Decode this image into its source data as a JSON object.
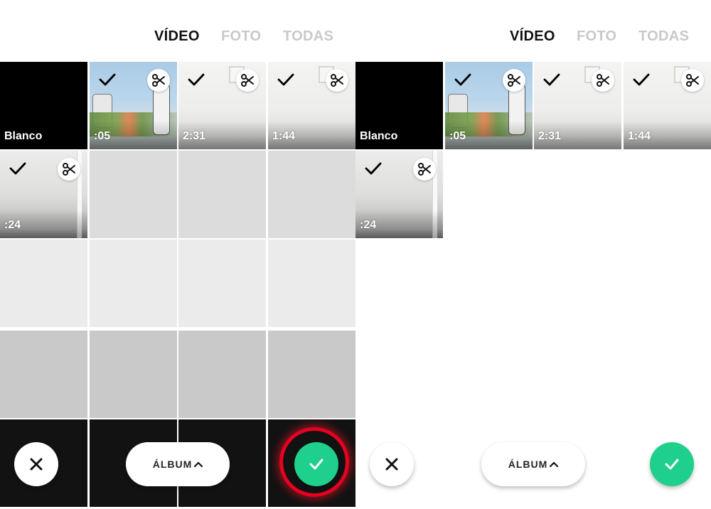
{
  "colors": {
    "accent_green": "#1fcf8c",
    "highlight_red": "#e8001f",
    "tab_active": "#111111",
    "tab_inactive": "#c9c9c9"
  },
  "tabs": [
    "VÍDEO",
    "FOTO",
    "TODAS"
  ],
  "active_tab": "VÍDEO",
  "media_items": [
    {
      "label": "Blanco",
      "kind": "blank",
      "selected": false
    },
    {
      "label": ":05",
      "kind": "cartoon",
      "selected": true
    },
    {
      "label": "2:31",
      "kind": "wall",
      "selected": true
    },
    {
      "label": "1:44",
      "kind": "wall",
      "selected": true
    },
    {
      "label": ":24",
      "kind": "room",
      "selected": true
    }
  ],
  "icons": {
    "selected_mark": "checkmark-icon",
    "trim": "scissors-icon",
    "close": "close-icon",
    "album_toggle": "chevron-up-icon",
    "confirm": "checkmark-icon"
  },
  "bottom_bar": {
    "album_label": "ÁLBUM"
  }
}
